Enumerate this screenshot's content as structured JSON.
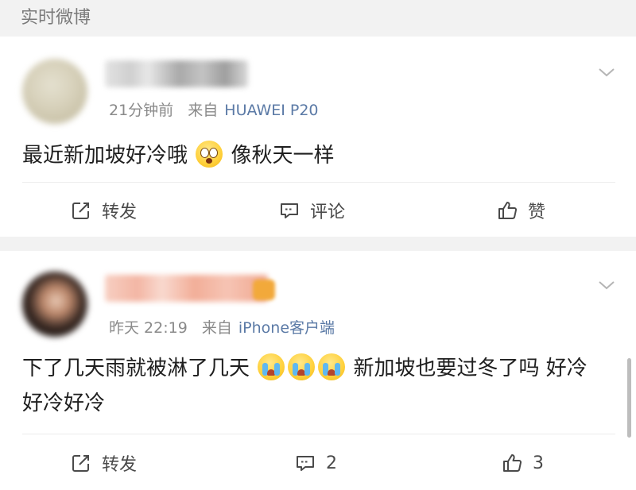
{
  "header": {
    "title": "实时微博"
  },
  "posts": [
    {
      "time": "21分钟前",
      "source_prefix": "来自",
      "device": "HUAWEI P20",
      "text_parts": [
        "最近新加坡好冷哦",
        "像秋天一样"
      ],
      "emojis": [
        "shocked-face"
      ],
      "actions": {
        "repost": "转发",
        "comment": "评论",
        "like": "赞"
      }
    },
    {
      "time": "昨天 22:19",
      "source_prefix": "来自",
      "device": "iPhone客户端",
      "text_parts": [
        "下了几天雨就被淋了几天",
        "新加坡也要过冬了吗 好冷好冷好冷"
      ],
      "emojis": [
        "crying-face",
        "crying-face",
        "crying-face"
      ],
      "actions": {
        "repost": "转发",
        "comment": "2",
        "like": "3"
      }
    }
  ],
  "colors": {
    "link": "#5b7aa6",
    "meta": "#8a8a8a",
    "background": "#f2f2f2"
  }
}
